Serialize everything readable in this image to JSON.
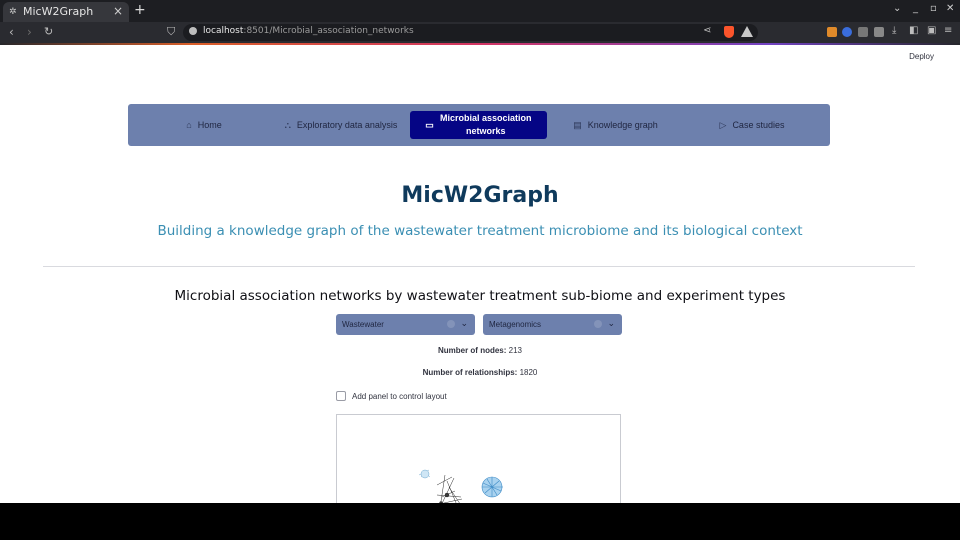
{
  "browser": {
    "tab_title": "MicW2Graph",
    "url_host": "localhost",
    "url_path": ":8501/Microbial_association_networks"
  },
  "app": {
    "deploy_label": "Deploy",
    "menu": [
      {
        "label": "Home",
        "icon": "house-icon",
        "glyph": "⌂",
        "active": false
      },
      {
        "label": "Exploratory data analysis",
        "icon": "diagram-icon",
        "glyph": "⛬",
        "active": false
      },
      {
        "label": "Microbial association networks",
        "icon": "monitor-icon",
        "glyph": "▭",
        "active": true
      },
      {
        "label": "Knowledge graph",
        "icon": "chat-icon",
        "glyph": "▤",
        "active": false
      },
      {
        "label": "Case studies",
        "icon": "play-icon",
        "glyph": "▷",
        "active": false
      }
    ],
    "title": "MicW2Graph",
    "subtitle": "Building a knowledge graph of the wastewater treatment microbiome and its biological context",
    "section_title": "Microbial association networks by wastewater treatment sub-biome and experiment types",
    "selects": {
      "biome": {
        "value": "Wastewater"
      },
      "experiment": {
        "value": "Metagenomics"
      }
    },
    "stats": {
      "nodes_label": "Number of nodes:",
      "nodes_value": "213",
      "relationships_label": "Number of relationships:",
      "relationships_value": "1820"
    },
    "layout_checkbox_label": "Add panel to control layout",
    "colors": {
      "menu_bg": "#6d80ad",
      "menu_active": "#050585",
      "title": "#0f3a5c",
      "subtitle": "#3b8fb3"
    }
  }
}
